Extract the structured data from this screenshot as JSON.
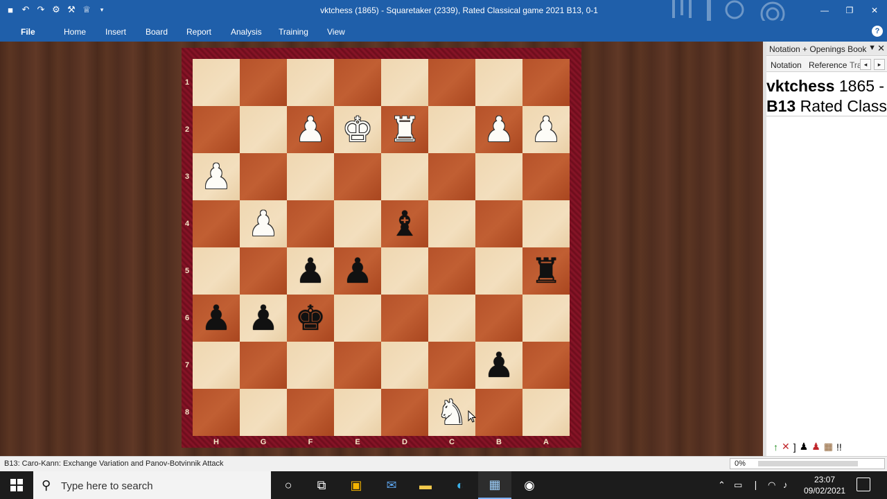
{
  "window": {
    "title": "vktchess (1865) - Squaretaker (2339), Rated Classical game 2021  B13, 0-1"
  },
  "ribbon": {
    "tabs": [
      "File",
      "Home",
      "Insert",
      "Board",
      "Report",
      "Analysis",
      "Training",
      "View"
    ]
  },
  "board": {
    "ranks": [
      "1",
      "2",
      "3",
      "4",
      "5",
      "6",
      "7",
      "8"
    ],
    "files": [
      "H",
      "G",
      "F",
      "E",
      "D",
      "C",
      "B",
      "A"
    ],
    "pieces": [
      {
        "file": "F",
        "rank": "2",
        "color": "white",
        "type": "pawn",
        "glyph": "♟"
      },
      {
        "file": "E",
        "rank": "2",
        "color": "white",
        "type": "king",
        "glyph": "♚"
      },
      {
        "file": "D",
        "rank": "2",
        "color": "white",
        "type": "rook",
        "glyph": "♜"
      },
      {
        "file": "B",
        "rank": "2",
        "color": "white",
        "type": "pawn",
        "glyph": "♟"
      },
      {
        "file": "A",
        "rank": "2",
        "color": "white",
        "type": "pawn",
        "glyph": "♟"
      },
      {
        "file": "H",
        "rank": "3",
        "color": "white",
        "type": "pawn",
        "glyph": "♟"
      },
      {
        "file": "G",
        "rank": "4",
        "color": "white",
        "type": "pawn",
        "glyph": "♟"
      },
      {
        "file": "D",
        "rank": "4",
        "color": "black",
        "type": "bishop",
        "glyph": "♝"
      },
      {
        "file": "F",
        "rank": "5",
        "color": "black",
        "type": "pawn",
        "glyph": "♟"
      },
      {
        "file": "E",
        "rank": "5",
        "color": "black",
        "type": "pawn",
        "glyph": "♟"
      },
      {
        "file": "A",
        "rank": "5",
        "color": "black",
        "type": "rook",
        "glyph": "♜"
      },
      {
        "file": "H",
        "rank": "6",
        "color": "black",
        "type": "pawn",
        "glyph": "♟"
      },
      {
        "file": "G",
        "rank": "6",
        "color": "black",
        "type": "pawn",
        "glyph": "♟"
      },
      {
        "file": "F",
        "rank": "6",
        "color": "black",
        "type": "king",
        "glyph": "♚"
      },
      {
        "file": "B",
        "rank": "7",
        "color": "black",
        "type": "pawn",
        "glyph": "♟"
      },
      {
        "file": "C",
        "rank": "8",
        "color": "white",
        "type": "knight",
        "glyph": "♞"
      }
    ]
  },
  "panel": {
    "header": "Notation + Openings Book",
    "tabs": [
      "Notation",
      "Reference",
      "Tra"
    ],
    "line1_bold": "vktchess",
    "line1_rest": " 1865 - ",
    "line2_bold": "B13",
    "line2_rest": " Rated Classi"
  },
  "status": {
    "opening": "B13: Caro-Kann: Exchange Variation and Panov-Botvinnik Attack",
    "progress_label": "0%",
    "progress_value": 0
  },
  "taskbar": {
    "search_placeholder": "Type here to search",
    "time": "23:07",
    "date": "09/02/2021"
  },
  "colors": {
    "ribbon": "#1f5faa",
    "light_square": "#f0d9b5",
    "dark_square": "#b6522a",
    "frame": "#7a1022"
  }
}
